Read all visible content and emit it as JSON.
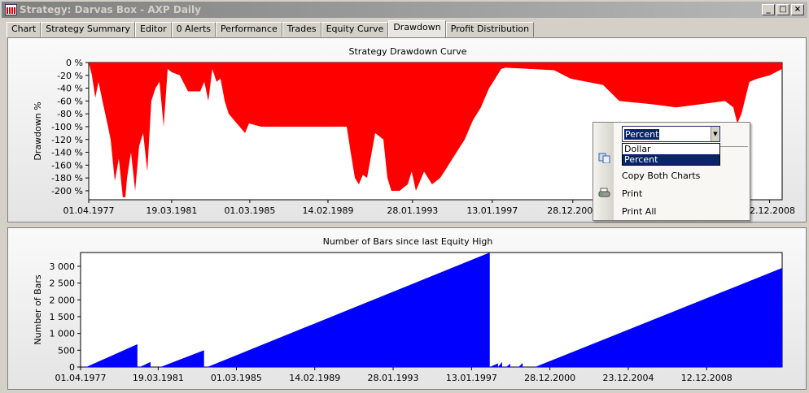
{
  "window": {
    "title": "Strategy: Darvas Box - AXP Daily",
    "buttons": [
      "_",
      "□",
      "×"
    ]
  },
  "tabs": [
    "Chart",
    "Strategy Summary",
    "Editor",
    "0 Alerts",
    "Performance",
    "Trades",
    "Equity Curve",
    "Drawdown",
    "Profit Distribution"
  ],
  "active_tab": "Drawdown",
  "context_menu": {
    "combo_value": "Percent",
    "options": [
      "Dollar",
      "Percent"
    ],
    "selected": "Percent",
    "items": [
      "Copy Both Charts",
      "Print",
      "Print All"
    ]
  },
  "chart_data": [
    {
      "type": "area",
      "title": "Strategy Drawdown Curve",
      "ylabel": "Drawdown %",
      "color": "#ff0000",
      "ylim": [
        -214,
        0
      ],
      "xlim": [
        1977.25,
        2012.03
      ],
      "yticks": [
        {
          "v": 0,
          "label": "0 %"
        },
        {
          "v": -20,
          "label": "-20 %"
        },
        {
          "v": -40,
          "label": "-40 %"
        },
        {
          "v": -60,
          "label": "-60 %"
        },
        {
          "v": -80,
          "label": "-80 %"
        },
        {
          "v": -100,
          "label": "-100 %"
        },
        {
          "v": -120,
          "label": "-120 %"
        },
        {
          "v": -140,
          "label": "-140 %"
        },
        {
          "v": -160,
          "label": "-160 %"
        },
        {
          "v": -180,
          "label": "-180 %"
        },
        {
          "v": -200,
          "label": "-200 %"
        }
      ],
      "xticks": [
        {
          "v": 1977.25,
          "label": "01.04.1977"
        },
        {
          "v": 1981.41,
          "label": "19.03.1981"
        },
        {
          "v": 1985.33,
          "label": "01.03.1985"
        },
        {
          "v": 1989.25,
          "label": "14.02.1989"
        },
        {
          "v": 1993.49,
          "label": "28.01.1993"
        },
        {
          "v": 1997.49,
          "label": "13.01.1997"
        },
        {
          "v": 2001.53,
          "label": "28.12.2000"
        },
        {
          "v": 2011.4,
          "label": "12.12.2008"
        }
      ],
      "x": [
        1977.25,
        1977.41,
        1977.58,
        1977.74,
        1977.94,
        1978.15,
        1978.35,
        1978.56,
        1978.76,
        1978.96,
        1979.09,
        1979.17,
        1979.37,
        1979.58,
        1979.78,
        1979.98,
        1980.19,
        1980.39,
        1980.6,
        1980.8,
        1981.01,
        1981.21,
        1981.41,
        1981.82,
        1982.23,
        1982.84,
        1983.05,
        1983.25,
        1983.45,
        1983.66,
        1983.86,
        1984.07,
        1984.27,
        1984.68,
        1985.09,
        1985.29,
        1985.9,
        1988.35,
        1990.19,
        1990.39,
        1990.6,
        1990.8,
        1991.0,
        1991.21,
        1991.62,
        1992.03,
        1992.23,
        1992.43,
        1992.84,
        1993.25,
        1993.45,
        1993.66,
        1994.07,
        1994.47,
        1994.88,
        1995.09,
        1995.29,
        1995.7,
        1996.11,
        1996.52,
        1996.92,
        1997.33,
        1997.54,
        1997.74,
        1997.94,
        1998.15,
        1999.37,
        2000.6,
        2001.41,
        2002.23,
        2003.05,
        2003.86,
        2005.5,
        2006.72,
        2007.94,
        2009.17,
        2009.58,
        2009.78,
        2009.99,
        2010.19,
        2010.39,
        2010.8,
        2011.41,
        2012.03
      ],
      "y": [
        0,
        -20,
        -55,
        -30,
        -60,
        -90,
        -120,
        -185,
        -150,
        -210,
        -210,
        -180,
        -140,
        -200,
        -130,
        -110,
        -170,
        -60,
        -40,
        -30,
        -100,
        -10,
        -15,
        -20,
        -45,
        -45,
        -30,
        -60,
        -10,
        -30,
        -25,
        -60,
        -80,
        -95,
        -110,
        -95,
        -100,
        -100,
        -100,
        -140,
        -180,
        -190,
        -175,
        -180,
        -110,
        -120,
        -180,
        -200,
        -200,
        -190,
        -170,
        -200,
        -170,
        -190,
        -180,
        -170,
        -160,
        -140,
        -120,
        -90,
        -70,
        -40,
        -30,
        -20,
        -10,
        -8,
        -10,
        -12,
        -25,
        -30,
        -35,
        -60,
        -65,
        -70,
        -65,
        -60,
        -70,
        -95,
        -80,
        -55,
        -30,
        -25,
        -20,
        -10
      ]
    },
    {
      "type": "area",
      "title": "Number of Bars since last Equity High",
      "ylabel": "Number of Bars",
      "color": "#0000ff",
      "ylim": [
        0,
        3410
      ],
      "xlim": [
        1977.25,
        2013.05
      ],
      "yticks": [
        {
          "v": 0,
          "label": "0"
        },
        {
          "v": 500,
          "label": "500"
        },
        {
          "v": 1000,
          "label": "1 000"
        },
        {
          "v": 1500,
          "label": "1 500"
        },
        {
          "v": 2000,
          "label": "2 000"
        },
        {
          "v": 2500,
          "label": "2 500"
        },
        {
          "v": 3000,
          "label": "3 000"
        }
      ],
      "xticks": [
        {
          "v": 1977.25,
          "label": "01.04.1977"
        },
        {
          "v": 1981.21,
          "label": "19.03.1981"
        },
        {
          "v": 1985.2,
          "label": "01.03.1985"
        },
        {
          "v": 1989.2,
          "label": "14.02.1989"
        },
        {
          "v": 1993.2,
          "label": "28.01.1993"
        },
        {
          "v": 1997.2,
          "label": "13.01.1997"
        },
        {
          "v": 2001.2,
          "label": "28.12.2000"
        },
        {
          "v": 2005.2,
          "label": "23.12.2004"
        },
        {
          "v": 2009.2,
          "label": "12.12.2008"
        }
      ],
      "x": [
        1977.25,
        1977.54,
        1980.15,
        1980.15,
        1980.28,
        1980.82,
        1980.82,
        1980.91,
        1981.33,
        1983.55,
        1983.55,
        1983.72,
        1998.13,
        1998.13,
        1998.55,
        1998.55,
        1998.76,
        1998.76,
        1998.97,
        1999.18,
        1999.18,
        1999.6,
        1999.81,
        1999.81,
        2000.02,
        2000.44,
        2013.05
      ],
      "y": [
        0,
        0,
        680,
        0,
        0,
        150,
        0,
        0,
        0,
        500,
        0,
        0,
        3410,
        0,
        110,
        0,
        150,
        0,
        0,
        100,
        0,
        0,
        120,
        0,
        0,
        0,
        2950
      ]
    }
  ]
}
